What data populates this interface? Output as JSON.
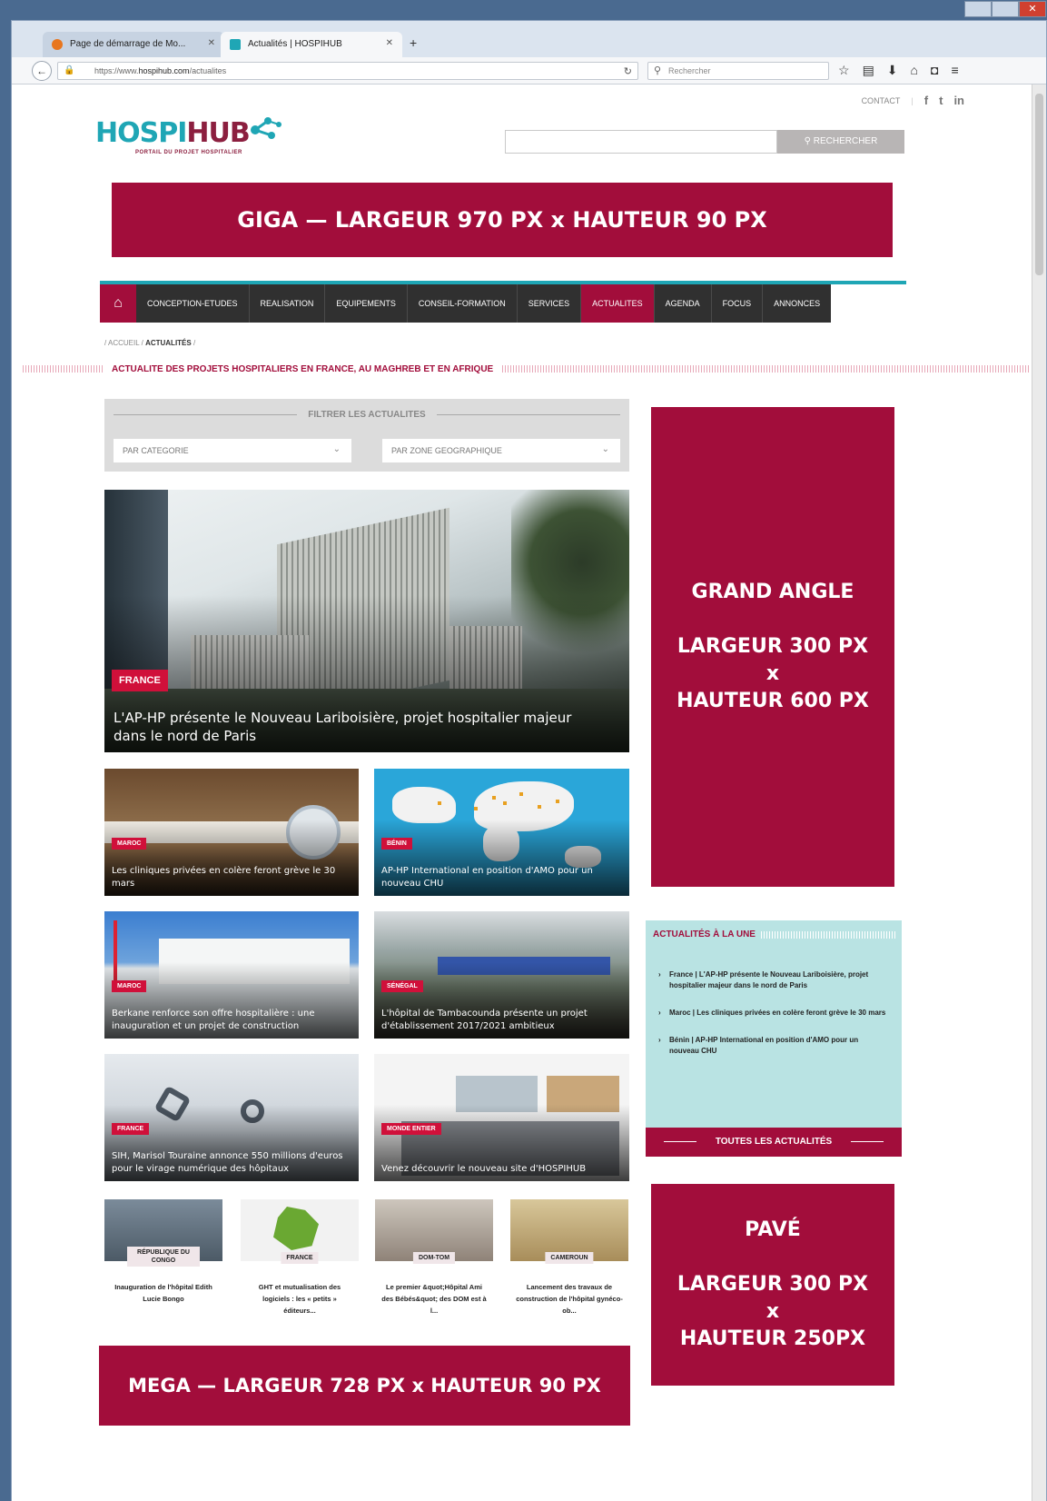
{
  "browser": {
    "tabs": [
      {
        "label": "Page de démarrage de Mo...",
        "active": false
      },
      {
        "label": "Actualités | HOSPIHUB",
        "active": true
      }
    ],
    "url_prefix": "https://www.",
    "url_host": "hospihub.com",
    "url_path": "/actualites",
    "search_placeholder": "Rechercher"
  },
  "header": {
    "contact": "CONTACT",
    "social": [
      "f",
      "t",
      "in"
    ],
    "logo_part1": "HOSPI",
    "logo_part2": "HUB",
    "logo_tagline": "PORTAIL DU PROJET HOSPITALIER",
    "search_button": "RECHERCHER"
  },
  "ads": {
    "giga": "GIGA — LARGEUR 970 PX x HAUTEUR 90 PX",
    "grand_line1": "GRAND ANGLE",
    "grand_line2": "LARGEUR 300 PX",
    "grand_line3": "x",
    "grand_line4": "HAUTEUR 600 PX",
    "pave_line1": "PAVÉ",
    "pave_line2": "LARGEUR 300 PX",
    "pave_line3": "x",
    "pave_line4": "HAUTEUR 250PX",
    "mega": "MEGA — LARGEUR 728 PX x HAUTEUR 90 PX"
  },
  "nav": {
    "items": [
      "CONCEPTION-ETUDES",
      "REALISATION",
      "EQUIPEMENTS",
      "CONSEIL-FORMATION",
      "SERVICES",
      "ACTUALITES",
      "AGENDA",
      "FOCUS",
      "ANNONCES"
    ],
    "active": "ACTUALITES"
  },
  "breadcrumb": {
    "home": "/ ACCUEIL /",
    "current": "ACTUALITÉS",
    "sep": "/"
  },
  "section_title": "ACTUALITE DES PROJETS HOSPITALIERS EN FRANCE, AU MAGHREB ET EN AFRIQUE",
  "filter": {
    "title": "FILTRER LES ACTUALITES",
    "category": "PAR CATEGORIE",
    "zone": "PAR ZONE GEOGRAPHIQUE"
  },
  "featured": {
    "badge": "FRANCE",
    "title": "L'AP-HP présente le Nouveau Lariboisière, projet hospitalier majeur dans le nord de Paris"
  },
  "cards": [
    {
      "badge": "MAROC",
      "title": "Les cliniques privées en colère feront grève le 30 mars"
    },
    {
      "badge": "BÉNIN",
      "title": "AP-HP International en position d'AMO pour un nouveau CHU"
    },
    {
      "badge": "MAROC",
      "title": "Berkane renforce son offre hospitalière : une inauguration et un projet de construction"
    },
    {
      "badge": "SÉNÉGAL",
      "title": "L'hôpital de Tambacounda présente un projet d'établissement 2017/2021 ambitieux"
    },
    {
      "badge": "FRANCE",
      "title": "SIH, Marisol Touraine annonce 550 millions d'euros pour le virage numérique des hôpitaux"
    },
    {
      "badge": "MONDE ENTIER",
      "title": "Venez découvrir le nouveau site d'HOSPIHUB"
    }
  ],
  "mini_cards": [
    {
      "badge": "RÉPUBLIQUE DU CONGO",
      "title": "Inauguration de l'hôpital Edith Lucie Bongo"
    },
    {
      "badge": "FRANCE",
      "title": "GHT et mutualisation des logiciels : les « petits » éditeurs..."
    },
    {
      "badge": "DOM-TOM",
      "title": "Le premier &quot;Hôpital Ami des Bébés&quot; des DOM est à l..."
    },
    {
      "badge": "CAMEROUN",
      "title": "Lancement des travaux de construction de l'hôpital gynéco-ob..."
    }
  ],
  "une": {
    "title": "ACTUALITÉS À LA UNE",
    "items": [
      "France | L'AP-HP présente le Nouveau Lariboisière, projet hospitalier majeur dans le nord de Paris",
      "Maroc | Les cliniques privées en colère feront grève le 30 mars",
      "Bénin | AP-HP International en position d'AMO pour un nouveau CHU"
    ],
    "all_button": "TOUTES LES ACTUALITÉS"
  },
  "colors": {
    "brand": "#a20d3b",
    "teal": "#1fa6b5",
    "nav_dark": "#303030"
  },
  "icons": {
    "home": "home-icon",
    "search": "search-icon",
    "chevron": "chevron-down-icon"
  }
}
